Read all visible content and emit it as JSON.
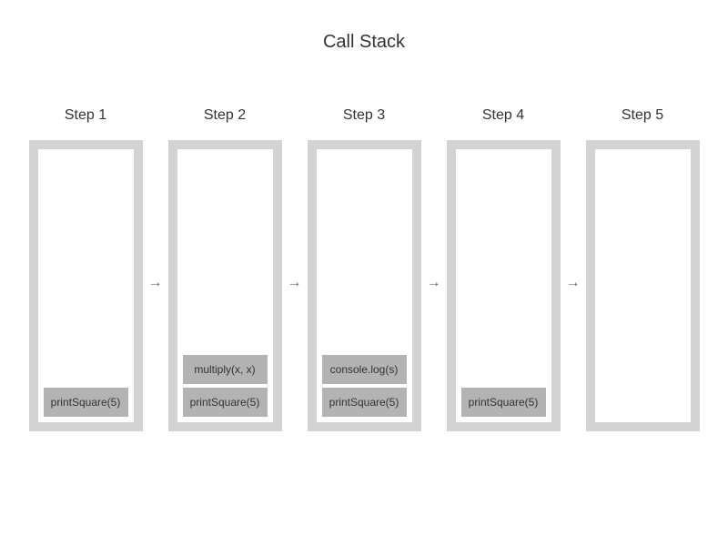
{
  "title": "Call Stack",
  "arrow_glyph": "→",
  "steps": [
    {
      "label": "Step 1",
      "frames": [
        "printSquare(5)"
      ]
    },
    {
      "label": "Step 2",
      "frames": [
        "printSquare(5)",
        "multiply(x, x)"
      ]
    },
    {
      "label": "Step 3",
      "frames": [
        "printSquare(5)",
        "console.log(s)"
      ]
    },
    {
      "label": "Step 4",
      "frames": [
        "printSquare(5)"
      ]
    },
    {
      "label": "Step 5",
      "frames": []
    }
  ]
}
